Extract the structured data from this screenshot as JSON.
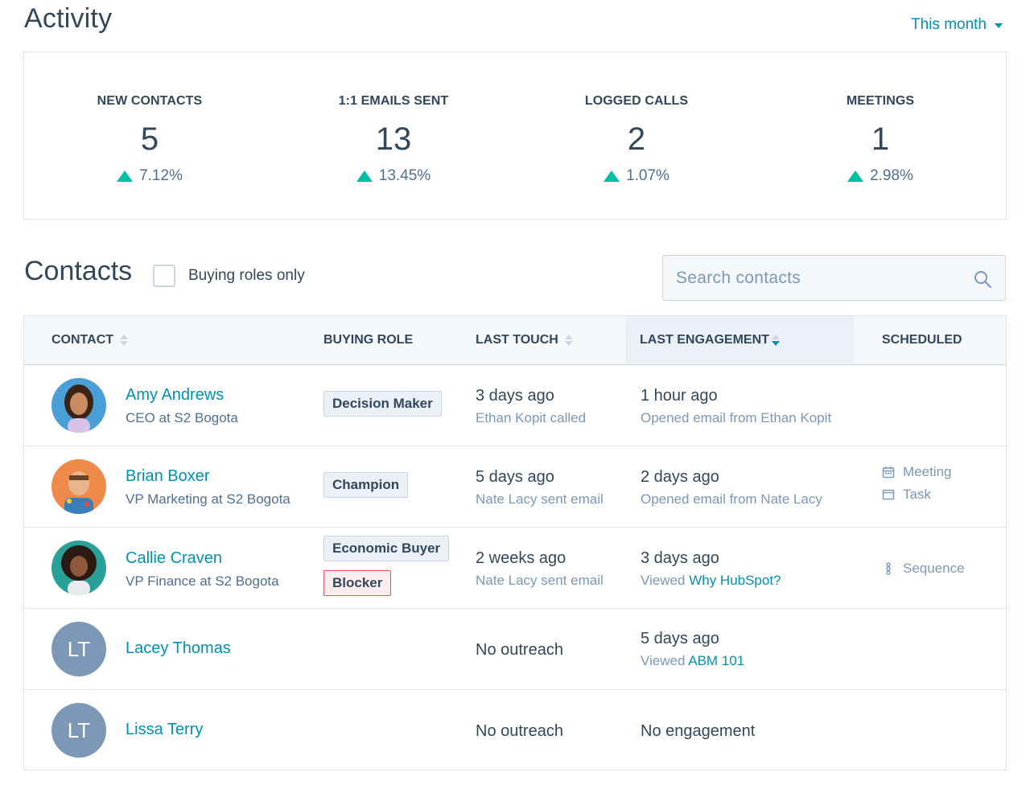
{
  "activity": {
    "title": "Activity",
    "period": "This month",
    "stats": [
      {
        "label": "NEW CONTACTS",
        "value": "5",
        "change": "7.12%"
      },
      {
        "label": "1:1 EMAILS SENT",
        "value": "13",
        "change": "13.45%"
      },
      {
        "label": "LOGGED CALLS",
        "value": "2",
        "change": "1.07%"
      },
      {
        "label": "MEETINGS",
        "value": "1",
        "change": "2.98%"
      }
    ]
  },
  "contacts": {
    "title": "Contacts",
    "buying_roles_label": "Buying roles only",
    "search_placeholder": "Search contacts",
    "columns": [
      "CONTACT",
      "BUYING ROLE",
      "LAST TOUCH",
      "LAST ENGAGEMENT",
      "SCHEDULED"
    ],
    "rows": [
      {
        "name": "Amy Andrews",
        "title": "CEO at S2 Bogota",
        "roles": [
          "Decision Maker"
        ],
        "last_touch": "3 days ago",
        "last_touch_detail": "Ethan Kopit called",
        "last_engagement": "1 hour ago",
        "engagement_detail": "Opened email from Ethan Kopit"
      },
      {
        "name": "Brian Boxer",
        "title": "VP Marketing at S2 Bogota",
        "roles": [
          "Champion"
        ],
        "last_touch": "5 days ago",
        "last_touch_detail": "Nate Lacy sent email",
        "last_engagement": "2 days ago",
        "engagement_detail": "Opened email from Nate Lacy",
        "scheduled": [
          "Meeting",
          "Task"
        ]
      },
      {
        "name": "Callie Craven",
        "title": "VP Finance at S2 Bogota",
        "roles": [
          "Economic Buyer",
          "Blocker"
        ],
        "last_touch": "2 weeks ago",
        "last_touch_detail": "Nate Lacy sent email",
        "last_engagement": "3 days ago",
        "engagement_prefix": "Viewed",
        "engagement_link": "Why HubSpot?",
        "scheduled": [
          "Sequence"
        ]
      },
      {
        "name": "Lacey Thomas",
        "initials": "LT",
        "last_touch": "No outreach",
        "last_engagement": "5 days ago",
        "engagement_prefix": "Viewed",
        "engagement_link": "ABM 101"
      },
      {
        "name": "Lissa Terry",
        "initials": "LT",
        "last_touch": "No outreach",
        "last_engagement": "No engagement"
      }
    ]
  },
  "colors": {
    "accent": "#0091ae",
    "positive": "#00bda5",
    "text": "#33475b",
    "muted": "#7c98b6",
    "blocker_border": "#f2545b"
  }
}
